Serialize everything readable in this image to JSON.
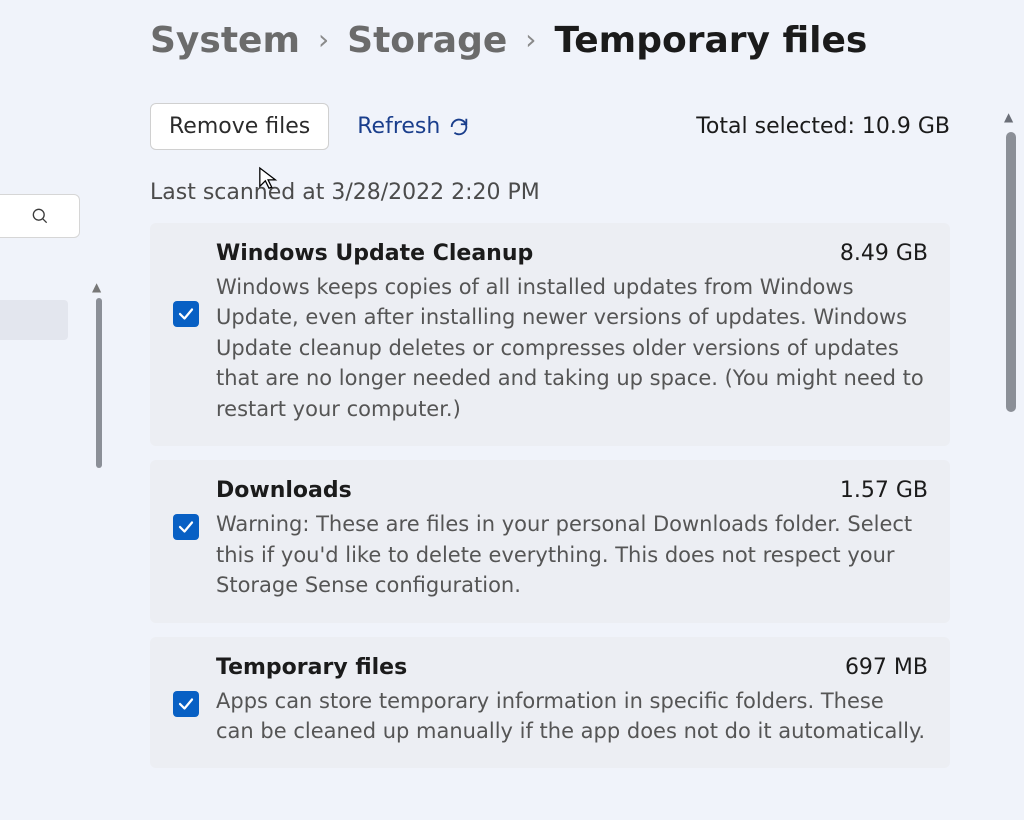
{
  "breadcrumb": {
    "system": "System",
    "storage": "Storage",
    "current": "Temporary files"
  },
  "actions": {
    "remove_label": "Remove files",
    "refresh_label": "Refresh"
  },
  "total_selected_label": "Total selected: 10.9 GB",
  "last_scanned": "Last scanned at 3/28/2022 2:20 PM",
  "icons": {
    "search": "search-icon",
    "refresh": "refresh-icon",
    "check": "check-icon",
    "cursor": "cursor-icon",
    "chevron_up": "chevron-up-icon"
  },
  "items": [
    {
      "title": "Windows Update Cleanup",
      "size": "8.49 GB",
      "description": "Windows keeps copies of all installed updates from Windows Update, even after installing newer versions of updates. Windows Update cleanup deletes or compresses older versions of updates that are no longer needed and taking up space. (You might need to restart your computer.)",
      "checked": true
    },
    {
      "title": "Downloads",
      "size": "1.57 GB",
      "description": "Warning: These are files in your personal Downloads folder. Select this if you'd like to delete everything. This does not respect your Storage Sense configuration.",
      "checked": true
    },
    {
      "title": "Temporary files",
      "size": "697 MB",
      "description": "Apps can store temporary information in specific folders. These can be cleaned up manually if the app does not do it automatically.",
      "checked": true
    }
  ]
}
